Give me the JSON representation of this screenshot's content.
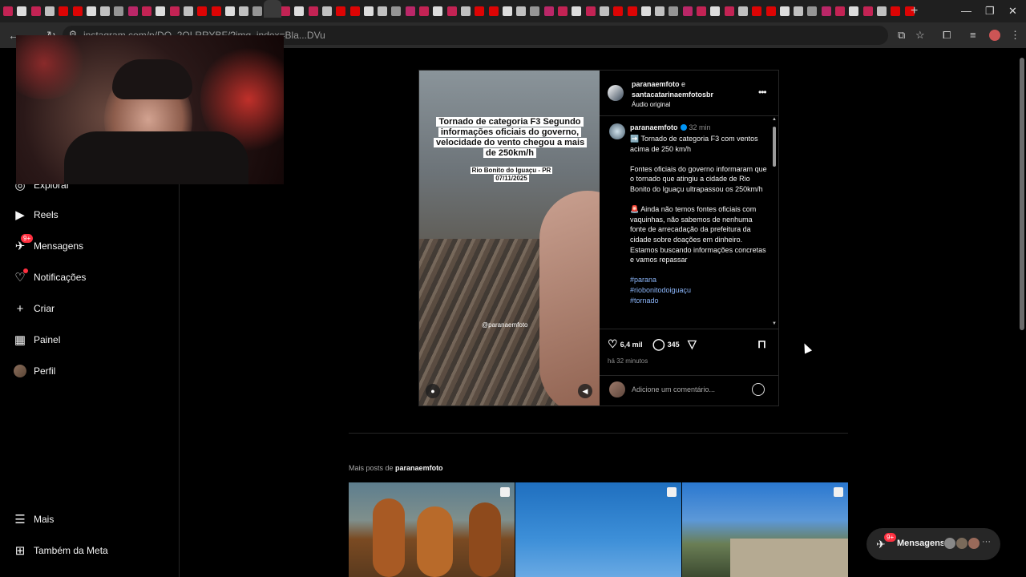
{
  "browser": {
    "url": "instagram.com/p/DQ_2OLRRYBF/?img_index=Bla...DVu",
    "new_tab": "+",
    "win_min": "—",
    "win_max": "❐",
    "win_close": "✕"
  },
  "sidebar": {
    "items": [
      {
        "label": "Explorar",
        "icon": "compass-icon"
      },
      {
        "label": "Reels",
        "icon": "reels-icon"
      },
      {
        "label": "Mensagens",
        "icon": "messenger-icon",
        "badge": "9+"
      },
      {
        "label": "Notificações",
        "icon": "heart-icon"
      },
      {
        "label": "Criar",
        "icon": "plus-icon"
      },
      {
        "label": "Painel",
        "icon": "dashboard-icon"
      },
      {
        "label": "Perfil",
        "icon": "avatar"
      }
    ],
    "bottom": [
      {
        "label": "Mais",
        "icon": "menu-icon"
      },
      {
        "label": "Também da Meta",
        "icon": "meta-icon"
      }
    ]
  },
  "post": {
    "media": {
      "title": "Tornado de categoria F3 Segundo informações oficiais do governo, velocidade do vento chegou a mais de 250km/h",
      "subtitle": "Rio Bonito do Iguaçu - PR 07/11/2025",
      "handle": "@paranaemfoto"
    },
    "header": {
      "author": "paranaemfoto",
      "and": "e",
      "coauthor": "santacatarinaemfotosbr",
      "audio": "Áudio original",
      "more": "•••"
    },
    "caption": {
      "author": "paranaemfoto",
      "time": "32 min",
      "p1": "➡️ Tornado de categoria F3 com ventos acima de 250 km/h",
      "p2": "Fontes oficiais do governo informaram que o tornado que atingiu a cidade de Rio Bonito do Iguaçu ultrapassou os 250km/h",
      "p3": "🚨 Ainda não temos fontes oficiais com vaquinhas, não sabemos de nenhuma fonte de arrecadação da prefeitura da cidade sobre doações em dinheiro. Estamos buscando informações concretas e vamos repassar",
      "tags": [
        "#parana",
        "#riobonitodoiguaçu",
        "#tornado"
      ]
    },
    "actions": {
      "likes": "6,4 mil",
      "comments": "345",
      "time_ago": "há 32 minutos"
    },
    "comment_placeholder": "Adicione um comentário..."
  },
  "more_posts": {
    "prefix": "Mais posts de",
    "author": "paranaemfoto"
  },
  "messages_pill": {
    "label": "Mensagens",
    "badge": "9+"
  },
  "colors": {
    "background": "#000000",
    "border": "#262626",
    "notification_red": "#ff3040",
    "verified_blue": "#0095f6",
    "hashtag": "#8ab4f8"
  }
}
